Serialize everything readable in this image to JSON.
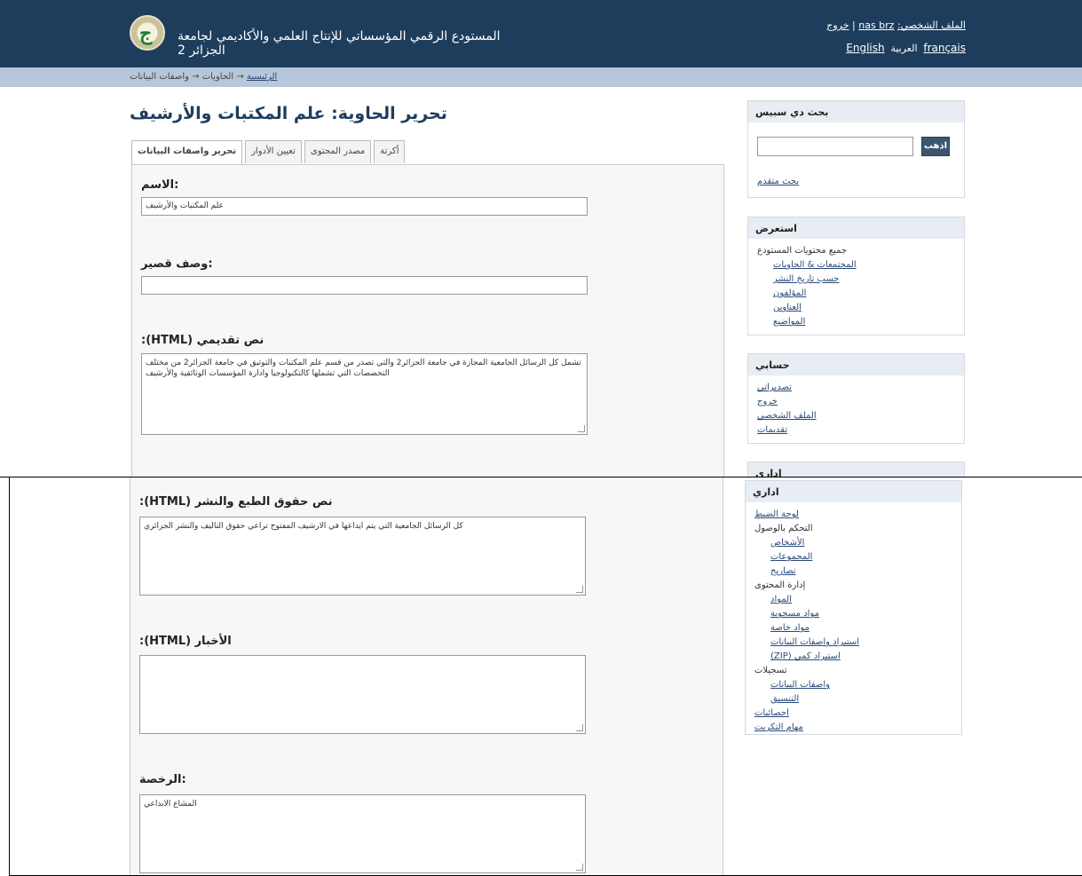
{
  "header": {
    "site_title": "المستودع الرقمي المؤسساتي للإنتاج العلمي والأكاديمي لجامعة الجزائر 2",
    "logout": "خروج",
    "separator": "|",
    "profile_prefix": ":الملف الشخصي",
    "username": "nas brz",
    "lang_en": "English",
    "lang_ar": "العربية",
    "lang_fr": "français"
  },
  "breadcrumb": {
    "home": "الرئيسية",
    "arrow1": "→",
    "collections": "الحاويات",
    "arrow2": "→",
    "current": "واصفات البيانات"
  },
  "page_title": "تحرير الحاوية: علم المكتبات والأرشيف",
  "tabs": [
    {
      "label": "تحرير واصفات البيانات"
    },
    {
      "label": "تعيين الأدوار"
    },
    {
      "label": "مصدر المحتوى"
    },
    {
      "label": "أكرتة"
    }
  ],
  "form": {
    "name_label": ":الاسم",
    "name_value": "علم المكتبات والأرشيف",
    "short_desc_label": ":وصف قصير",
    "short_desc_value": "",
    "intro_label": ":(HTML) نص تقديمي",
    "intro_value": "تشمل كل الرسائل الجامعية المجازة في جامعة الجزائر2 والتي تصدر من قسم علم المكتبات والتوثيق في جامعة الجزائر2 من مختلف التخصصات التي تشملها كالتكنولوجيا وادارة المؤسسات الوثائقية والأرشيف",
    "copyright_label": ":(HTML) نص حقوق الطبع والنشر",
    "copyright_value": "كل الرسائل الجامعية التي يتم ايداعها في الارشيف المفتوح تراعي حقوق التاليف والنشر الجزائري",
    "news_label": ":(HTML) الأخبار",
    "news_value": "",
    "license_label": ":الرخصة",
    "license_value": "المشاع الابداعي"
  },
  "sidebar": {
    "search": {
      "title": "بحث دي سبيس",
      "button": "اذهب",
      "advanced": "بحث متقدم"
    },
    "browse": {
      "title": "استعرض",
      "all_label": "جميع محتويات المستودع",
      "links": [
        "المجتمعات & الحاويات",
        "حسب تاريخ النشر",
        "المؤلفون",
        "العناوين",
        "المواضيع"
      ]
    },
    "account": {
      "title": "حسابي",
      "links": [
        "تصديراتي",
        "خروج",
        "الملف الشخصي",
        "تقديمات"
      ]
    },
    "admin": {
      "title": "اداري",
      "control_panel": "لوحة الضبط",
      "access_control": "التحكم بالوصول",
      "access_links": [
        "الأشخاص",
        "المجموعات",
        "تصاريح"
      ],
      "content_admin": "إدارة المحتوى",
      "content_links": [
        "المواد",
        "مواد مسحوبة",
        "مواد خاصة",
        "استيراد واصفات البيانات",
        "(ZIP) استيراد كمي"
      ],
      "registries": "تسجيلات",
      "registry_links": [
        "واصفات البيانات",
        "التنسيق"
      ],
      "statistics": "احصائيات",
      "curation": "مهام التكريت"
    }
  }
}
